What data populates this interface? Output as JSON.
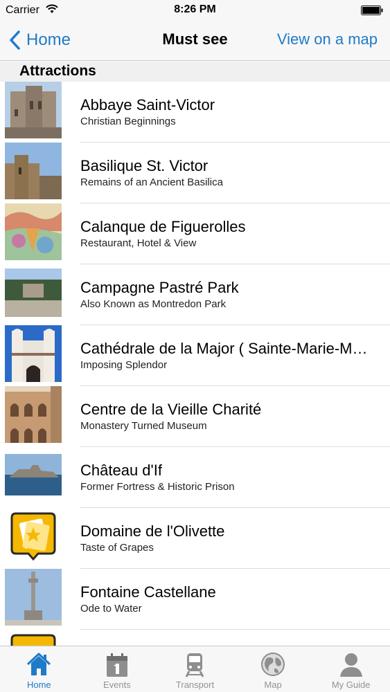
{
  "status_bar": {
    "carrier": "Carrier",
    "time": "8:26 PM"
  },
  "nav": {
    "back_label": "Home",
    "title": "Must see",
    "right_button": "View on a map"
  },
  "section": {
    "title": "Attractions"
  },
  "items": [
    {
      "title": "Abbaye Saint-Victor",
      "subtitle": "Christian Beginnings"
    },
    {
      "title": "Basilique St. Victor",
      "subtitle": "Remains of an Ancient Basilica"
    },
    {
      "title": "Calanque de Figuerolles",
      "subtitle": "Restaurant, Hotel & View"
    },
    {
      "title": "Campagne Pastré Park",
      "subtitle": "Also Known as Montredon Park"
    },
    {
      "title": "Cathédrale de la Major ( Sainte-Marie-Majeure )",
      "subtitle": "Imposing Splendor"
    },
    {
      "title": "Centre de la Vieille Charité",
      "subtitle": "Monastery Turned Museum"
    },
    {
      "title": "Château d'If",
      "subtitle": "Former Fortress & Historic Prison"
    },
    {
      "title": "Domaine de l'Olivette",
      "subtitle": "Taste of Grapes"
    },
    {
      "title": "Fontaine Castellane",
      "subtitle": "Ode to Water"
    }
  ],
  "tabs": [
    {
      "label": "Home",
      "icon": "house-icon",
      "active": true
    },
    {
      "label": "Events",
      "icon": "calendar-icon",
      "active": false
    },
    {
      "label": "Transport",
      "icon": "train-icon",
      "active": false
    },
    {
      "label": "Map",
      "icon": "globe-icon",
      "active": false
    },
    {
      "label": "My Guide",
      "icon": "person-icon",
      "active": false
    }
  ],
  "colors": {
    "accent": "#1f7ac8",
    "tab_inactive": "#929292",
    "bar_bg": "#f7f7f7",
    "section_bg": "#f0f0f0",
    "placeholder_icon": "#f5b800"
  }
}
